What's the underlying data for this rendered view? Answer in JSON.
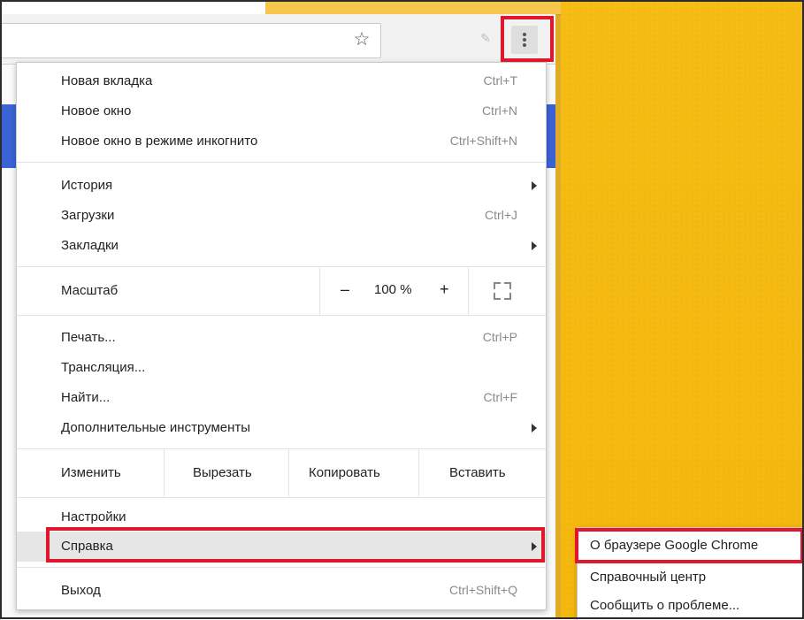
{
  "toolbar": {
    "star_icon": "star-outline-icon",
    "pencil_icon": "pencil-icon",
    "menu_icon": "three-dots-vertical-icon"
  },
  "menu": {
    "new_tab": {
      "label": "Новая вкладка",
      "shortcut": "Ctrl+T"
    },
    "new_window": {
      "label": "Новое окно",
      "shortcut": "Ctrl+N"
    },
    "incognito": {
      "label": "Новое окно в режиме инкогнито",
      "shortcut": "Ctrl+Shift+N"
    },
    "history": {
      "label": "История"
    },
    "downloads": {
      "label": "Загрузки",
      "shortcut": "Ctrl+J"
    },
    "bookmarks": {
      "label": "Закладки"
    },
    "zoom": {
      "label": "Масштаб",
      "minus": "–",
      "value": "100 %",
      "plus": "+"
    },
    "print": {
      "label": "Печать...",
      "shortcut": "Ctrl+P"
    },
    "cast": {
      "label": "Трансляция..."
    },
    "find": {
      "label": "Найти...",
      "shortcut": "Ctrl+F"
    },
    "more_tools": {
      "label": "Дополнительные инструменты"
    },
    "edit": {
      "label": "Изменить",
      "cut": "Вырезать",
      "copy": "Копировать",
      "paste": "Вставить"
    },
    "settings": {
      "label": "Настройки"
    },
    "help": {
      "label": "Справка"
    },
    "exit": {
      "label": "Выход",
      "shortcut": "Ctrl+Shift+Q"
    }
  },
  "submenu": {
    "about": "О браузере Google Chrome",
    "help_center": "Справочный центр",
    "report": "Сообщить о проблеме..."
  },
  "colors": {
    "highlight": "#e0172c",
    "page_bg": "#f3b60d",
    "active_item": "#e6e6e6"
  }
}
